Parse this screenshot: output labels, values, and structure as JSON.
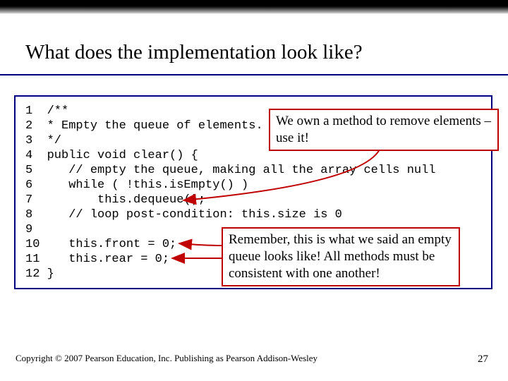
{
  "title": "What does the implementation look like?",
  "code": {
    "lines": [
      "1  /**",
      "2  * Empty the queue of elements.",
      "3  */",
      "4  public void clear() {",
      "5     // empty the queue, making all the array cells null",
      "6     while ( !this.isEmpty() )",
      "7         this.dequeue();",
      "8     // loop post-condition: this.size is 0",
      "9  ",
      "10    this.front = 0;",
      "11    this.rear = 0;",
      "12 }"
    ]
  },
  "callouts": {
    "top": "We own a method to remove elements – use it!",
    "bottom": "Remember, this is what we said an empty queue looks like! All methods must be consistent with one another!"
  },
  "footer": "Copyright © 2007 Pearson Education, Inc. Publishing as Pearson Addison-Wesley",
  "page": "27"
}
